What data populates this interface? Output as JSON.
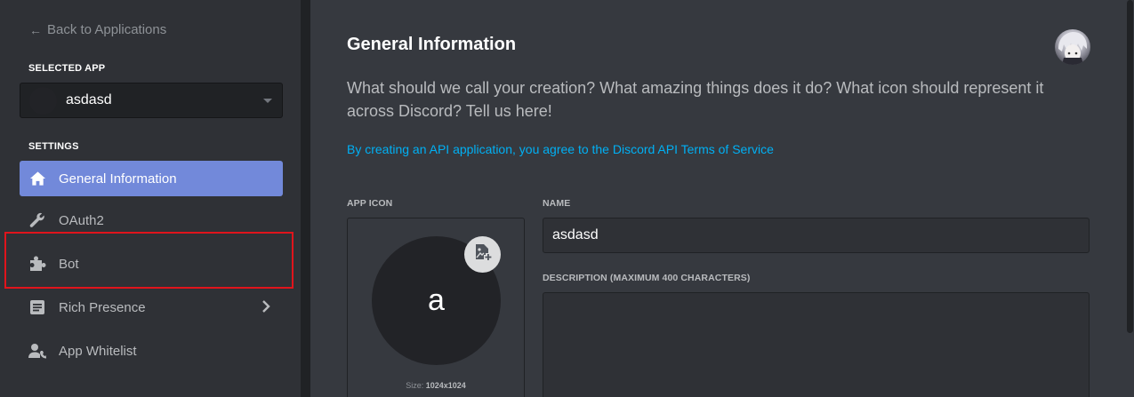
{
  "sidebar": {
    "back_label": "Back to Applications",
    "selected_app_label": "SELECTED APP",
    "selected_app_name": "asdasd",
    "settings_label": "SETTINGS",
    "items": [
      {
        "label": "General Information",
        "icon": "home-icon",
        "active": true
      },
      {
        "label": "OAuth2",
        "icon": "wrench-icon",
        "active": false
      },
      {
        "label": "Bot",
        "icon": "puzzle-piece-icon",
        "active": false
      },
      {
        "label": "Rich Presence",
        "icon": "document-icon",
        "active": false
      },
      {
        "label": "App Whitelist",
        "icon": "user-phone-icon",
        "active": false
      }
    ]
  },
  "main": {
    "title": "General Information",
    "description": "What should we call your creation? What amazing things does it do? What icon should represent it across Discord? Tell us here!",
    "tos_link": "By creating an API application, you agree to the Discord API Terms of Service",
    "app_icon_label": "APP ICON",
    "app_icon_letter": "a",
    "icon_size_prefix": "Size:",
    "icon_size_value": "1024x1024",
    "name_label": "NAME",
    "name_value": "asdasd",
    "description_label": "DESCRIPTION (MAXIMUM 400 CHARACTERS)",
    "description_value": ""
  },
  "colors": {
    "accent": "#7289da",
    "link": "#00b0f4",
    "highlight": "#e0141c",
    "sidebar_bg": "#2f3136",
    "main_bg": "#36393f"
  }
}
